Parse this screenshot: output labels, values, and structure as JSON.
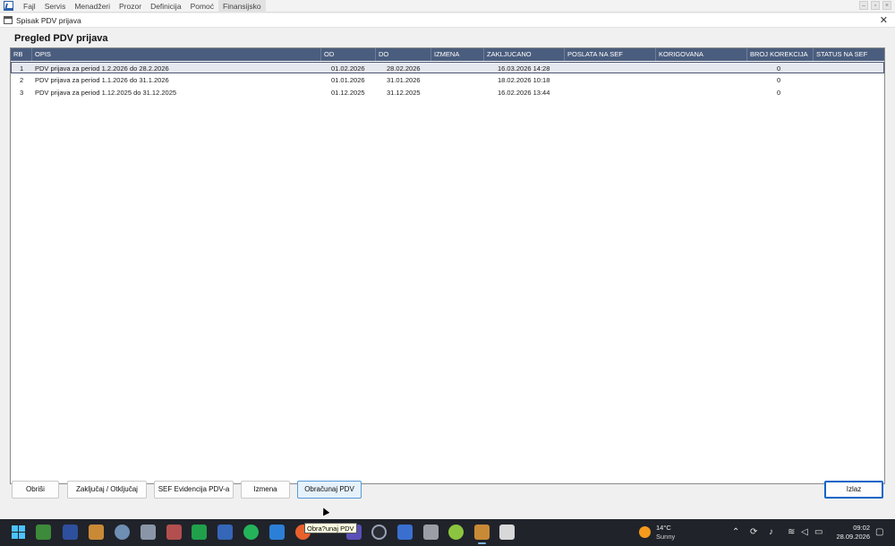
{
  "menubar": {
    "items": [
      "Fajl",
      "Servis",
      "Menadžeri",
      "Prozor",
      "Definicija",
      "Pomoć",
      "Finansijsko"
    ],
    "active_index": 6,
    "controls": [
      "–",
      "▫",
      "×"
    ]
  },
  "window": {
    "title": "Spisak PDV prijava",
    "close_glyph": "✕"
  },
  "page": {
    "title": "Pregled PDV prijava"
  },
  "grid": {
    "columns": [
      "RB",
      "OPIS",
      "OD",
      "DO",
      "IZMENA",
      "ZAKLJUCANO",
      "POSLATA NA SEF",
      "KORIGOVANA",
      "BROJ KOREKCIJA",
      "STATUS NA SEF"
    ],
    "rows": [
      {
        "rb": "1",
        "opis": "PDV prijava za period 1.2.2026 do 28.2.2026",
        "od": "01.02.2026",
        "do": "28.02.2026",
        "izmena": "",
        "zakljucano": "16.03.2026 14:28",
        "poslata": "",
        "korigovana": "",
        "broj_korekcija": "0",
        "status": ""
      },
      {
        "rb": "2",
        "opis": "PDV prijava za period 1.1.2026 do 31.1.2026",
        "od": "01.01.2026",
        "do": "31.01.2026",
        "izmena": "",
        "zakljucano": "18.02.2026 10:18",
        "poslata": "",
        "korigovana": "",
        "broj_korekcija": "0",
        "status": ""
      },
      {
        "rb": "3",
        "opis": "PDV prijava za period 1.12.2025 do 31.12.2025",
        "od": "01.12.2025",
        "do": "31.12.2025",
        "izmena": "",
        "zakljucano": "16.02.2026 13:44",
        "poslata": "",
        "korigovana": "",
        "broj_korekcija": "0",
        "status": ""
      }
    ],
    "selected_row": 0
  },
  "buttons": {
    "obrisi": "Obriši",
    "zakljucaj": "Zaključaj / Otključaj",
    "sef_evidencija": "SEF Evidencija PDV-a",
    "izmena": "Izmena",
    "obracunaj": "Obračunaj PDV",
    "izlaz": "Izlaz"
  },
  "tooltip": "Obra?unaj PDV",
  "taskbar": {
    "weather_temp": "14°C",
    "weather_desc": "Sunny",
    "time": "09:02",
    "date": "28.09.2026",
    "colors": {
      "bg": "#20232a",
      "sun": "#f59a1c",
      "grid_header": "#4a5d7e",
      "accent": "#0a64c8"
    }
  }
}
